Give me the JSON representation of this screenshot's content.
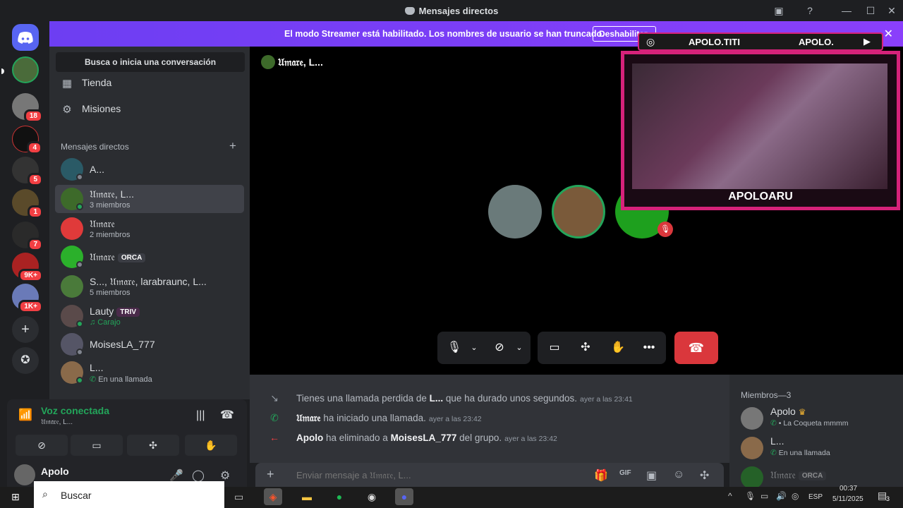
{
  "window": {
    "title": "Mensajes directos"
  },
  "banner": {
    "text": "El modo Streamer está habilitado. Los nombres de usuario se han truncado.",
    "button": "Deshabilitar"
  },
  "servers": [
    {
      "badge": ""
    },
    {
      "badge": "18"
    },
    {
      "badge": "4"
    },
    {
      "badge": "5"
    },
    {
      "badge": "1"
    },
    {
      "badge": "7"
    },
    {
      "badge": "9K+"
    },
    {
      "badge": "1K+"
    }
  ],
  "sidebar": {
    "search": "Busca o inicia una conversación",
    "nav": [
      {
        "label": "Tienda"
      },
      {
        "label": "Misiones"
      }
    ],
    "dm_header": "Mensajes directos",
    "dms": [
      {
        "name": "A...",
        "sub": ""
      },
      {
        "name": "𝔘𝔪𝔞𝔯𝔢, L...",
        "sub": "3 miembros"
      },
      {
        "name": "𝔘𝔪𝔞𝔯𝔢",
        "sub": "2 miembros"
      },
      {
        "name": "𝔘𝔪𝔞𝔯𝔢",
        "sub": "",
        "tag": "ORCA"
      },
      {
        "name": "S..., 𝔘𝔪𝔞𝔯𝔢, larabraunc, L...",
        "sub": "5 miembros"
      },
      {
        "name": "Lauty",
        "sub": "♫ Carajo",
        "tag": "TRIV"
      },
      {
        "name": "MoisesLA_777",
        "sub": ""
      },
      {
        "name": "L...",
        "sub": "En una llamada"
      }
    ]
  },
  "voice": {
    "status": "Voz conectada",
    "channel": "𝔘𝔪𝔞𝔯𝔢, L..."
  },
  "user": {
    "name": "Apolo"
  },
  "call": {
    "name": "𝔘𝔪𝔞𝔯𝔢, L..."
  },
  "overlay": {
    "instagram": "APOLO.TITI",
    "youtube": "APOLO.",
    "name": "APOLOARU"
  },
  "messages": [
    {
      "pre": "Tienes una llamada perdida de ",
      "bold": "L...",
      "post": " que ha durado unos segundos.",
      "ts": "ayer a las 23:41"
    },
    {
      "pre": "",
      "bold": "𝔘𝔪𝔞𝔯𝔢",
      "post": " ha iniciado una llamada.",
      "ts": "ayer a las 23:42"
    },
    {
      "pre": "",
      "bold": "Apolo",
      "post": " ha eliminado a ",
      "bold2": "MoisesLA_777",
      "post2": " del grupo.",
      "ts": "ayer a las 23:42"
    }
  ],
  "composer": {
    "placeholder": "Enviar mensaje a 𝔘𝔪𝔞𝔯𝔢, L..."
  },
  "members": {
    "header": "Miembros—3",
    "list": [
      {
        "name": "Apolo",
        "sub": "• La Coqueta mmmm"
      },
      {
        "name": "L...",
        "sub": "En una llamada"
      },
      {
        "name": "𝔘𝔪𝔞𝔯𝔢",
        "tag": "ORCA"
      }
    ]
  },
  "taskbar": {
    "search": "Buscar",
    "lang": "ESP",
    "time": "00:37",
    "date": "5/11/2025",
    "notif": "3"
  },
  "colors": {
    "brand": "#5865f2",
    "streamer_banner": "#7b3ff7",
    "hangup": "#da373c",
    "online": "#23a55a",
    "overlay_frame": "#d6227a"
  }
}
